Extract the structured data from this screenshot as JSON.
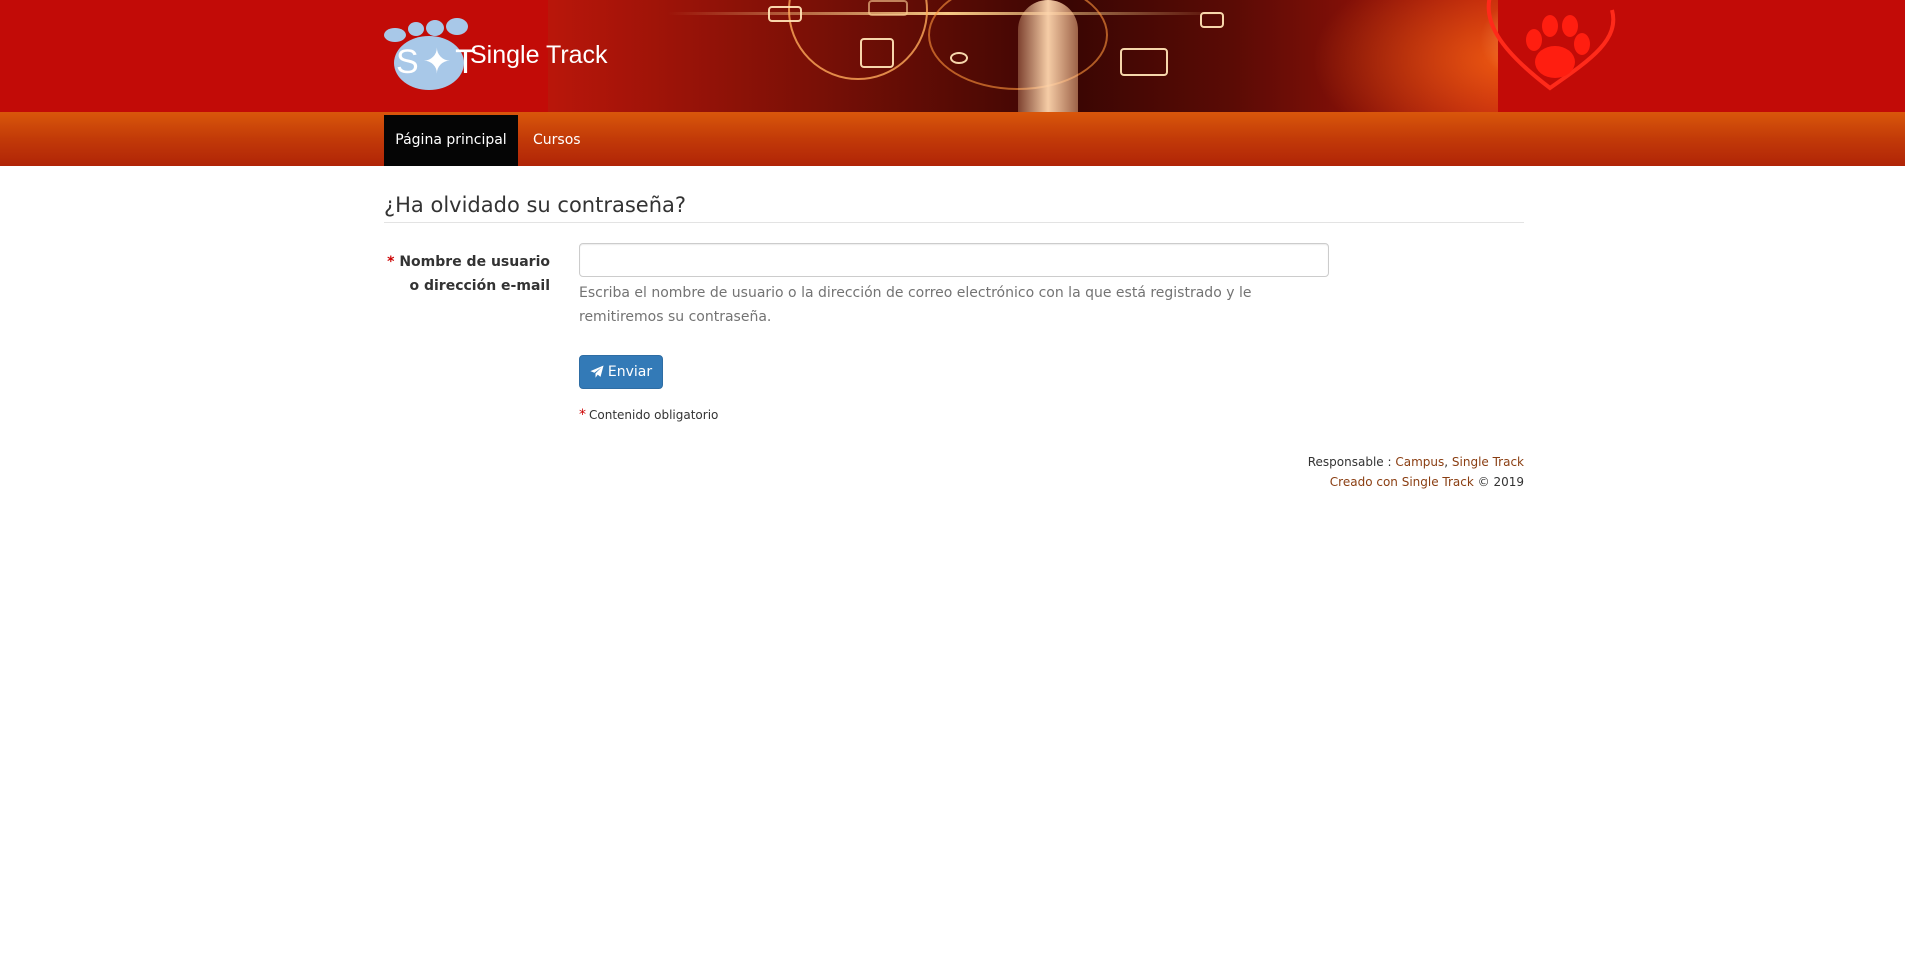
{
  "header": {
    "brand_name": "Single Track",
    "logo_letters": "S✦T"
  },
  "nav": {
    "items": [
      {
        "label": "Página principal",
        "active": true
      },
      {
        "label": "Cursos",
        "active": false
      }
    ]
  },
  "form": {
    "title": "¿Ha olvidado su contraseña?",
    "required_marker": "*",
    "field_label": "Nombre de usuario o dirección e-mail",
    "field_value": "",
    "help_text": "Escriba el nombre de usuario o la dirección de correo electrónico con la que está registrado y le remitiremos su contraseña.",
    "submit_label": "Enviar",
    "required_note": "Contenido obligatorio"
  },
  "footer": {
    "responsible_prefix": "Responsable : ",
    "responsible_link1": "Campus",
    "separator": ", ",
    "responsible_link2": "Single Track",
    "created_with": "Creado con Single Track",
    "copyright": " © 2019"
  },
  "icons": {
    "submit": "paper-plane-icon",
    "logo": "single-track-logo-icon",
    "paw": "paw-heart-icon"
  },
  "colors": {
    "header_red": "#c20b07",
    "nav_orange": "#c23a08",
    "nav_active": "#050505",
    "primary_button": "#337ab7",
    "required_red": "#cc0000",
    "footer_link": "#8a3e12"
  }
}
